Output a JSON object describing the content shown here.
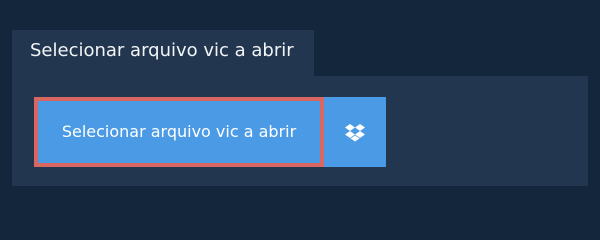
{
  "tab": {
    "label": "Selecionar arquivo vic a abrir"
  },
  "panel": {
    "select_button_label": "Selecionar arquivo vic a abrir",
    "dropbox_icon": "dropbox-icon"
  },
  "colors": {
    "background": "#14263b",
    "panel": "#22374f",
    "button": "#4a9ae6",
    "button_highlight_border": "#d86762",
    "text": "#ffffff"
  }
}
